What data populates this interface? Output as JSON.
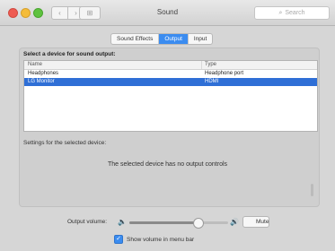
{
  "window": {
    "title": "Sound",
    "nav_back": "‹",
    "nav_forward": "›",
    "grid_glyph": "⊞",
    "search_icon": "⌕",
    "search_placeholder": "Search"
  },
  "tabs": [
    {
      "label": "Sound Effects",
      "active": false
    },
    {
      "label": "Output",
      "active": true
    },
    {
      "label": "Input",
      "active": false
    }
  ],
  "section_title": "Select a device for sound output:",
  "table": {
    "columns": [
      "Name",
      "Type"
    ],
    "rows": [
      {
        "name": "Headphones",
        "type": "Headphone port"
      },
      {
        "name": "LG Monitor",
        "type": "HDMI",
        "selected": true
      }
    ]
  },
  "settings_title": "Settings for the selected device:",
  "no_controls": "The selected device has no output controls",
  "volume": {
    "label": "Output volume:",
    "level": 0.69,
    "mute_label": "Mute",
    "low_icon": "speaker-low-icon",
    "high_icon": "speaker-high-icon"
  },
  "show_volume": {
    "label": "Show volume in menu bar",
    "checked": true
  },
  "colors": {
    "accent": "#3b8cf0",
    "selection": "#2f6fd6"
  }
}
